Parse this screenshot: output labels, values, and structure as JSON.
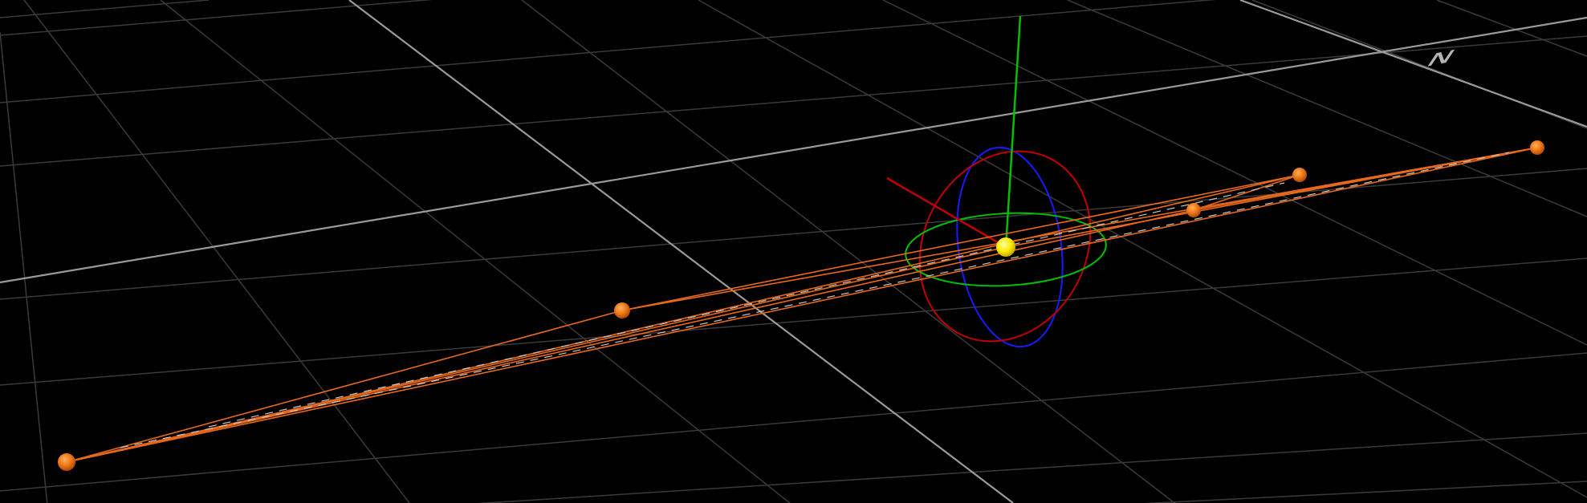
{
  "viewport": {
    "background": "#000000",
    "grid_color": "#3a3a3a",
    "axis_line_color": "#9a9a9a"
  },
  "compass": {
    "label": "N",
    "color": "#b4b4b4"
  },
  "gizmo": {
    "x_axis_color": "#c00000",
    "y_axis_color": "#00c000",
    "z_axis_color": "#1a1aff",
    "center_color": "#ffee00",
    "icon": "rotate-gizmo-icon"
  },
  "path": {
    "line_color": "#e8691b",
    "node_color": "#f07814",
    "dash_color": "#c8c8c8",
    "node_count": 6
  }
}
